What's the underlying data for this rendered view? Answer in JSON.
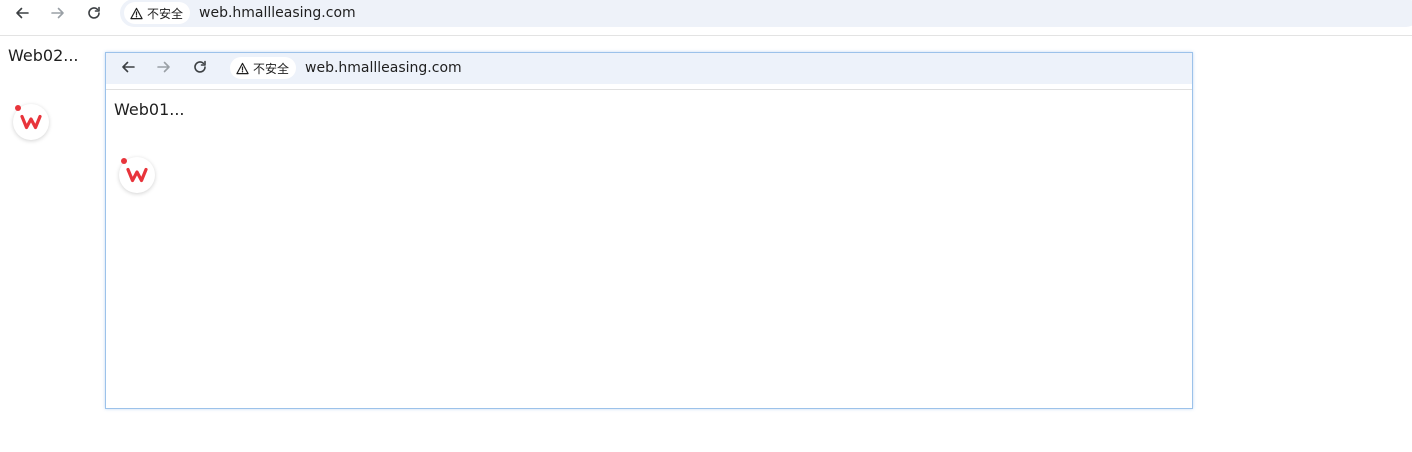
{
  "outer_browser": {
    "security_label": "不安全",
    "url": "web.hmallleasing.com",
    "page_heading": "Web02...",
    "icons": {
      "back": "back-arrow-icon",
      "forward": "forward-arrow-icon",
      "reload": "reload-icon",
      "warning": "warning-triangle-icon",
      "app_badge": "wps-logo-icon"
    }
  },
  "inner_browser": {
    "security_label": "不安全",
    "url": "web.hmallleasing.com",
    "page_heading": "Web01...",
    "icons": {
      "back": "back-arrow-icon",
      "forward": "forward-arrow-icon",
      "reload": "reload-icon",
      "warning": "warning-triangle-icon",
      "app_badge": "wps-logo-icon"
    }
  },
  "colors": {
    "omnibox_bg": "#eef2f9",
    "inner_toolbar_bg": "#edf2fa",
    "inner_window_border": "#9cc2ea",
    "wps_red": "#e8343b",
    "text": "#1f1f1f",
    "disabled_icon": "#9aa0a6"
  }
}
